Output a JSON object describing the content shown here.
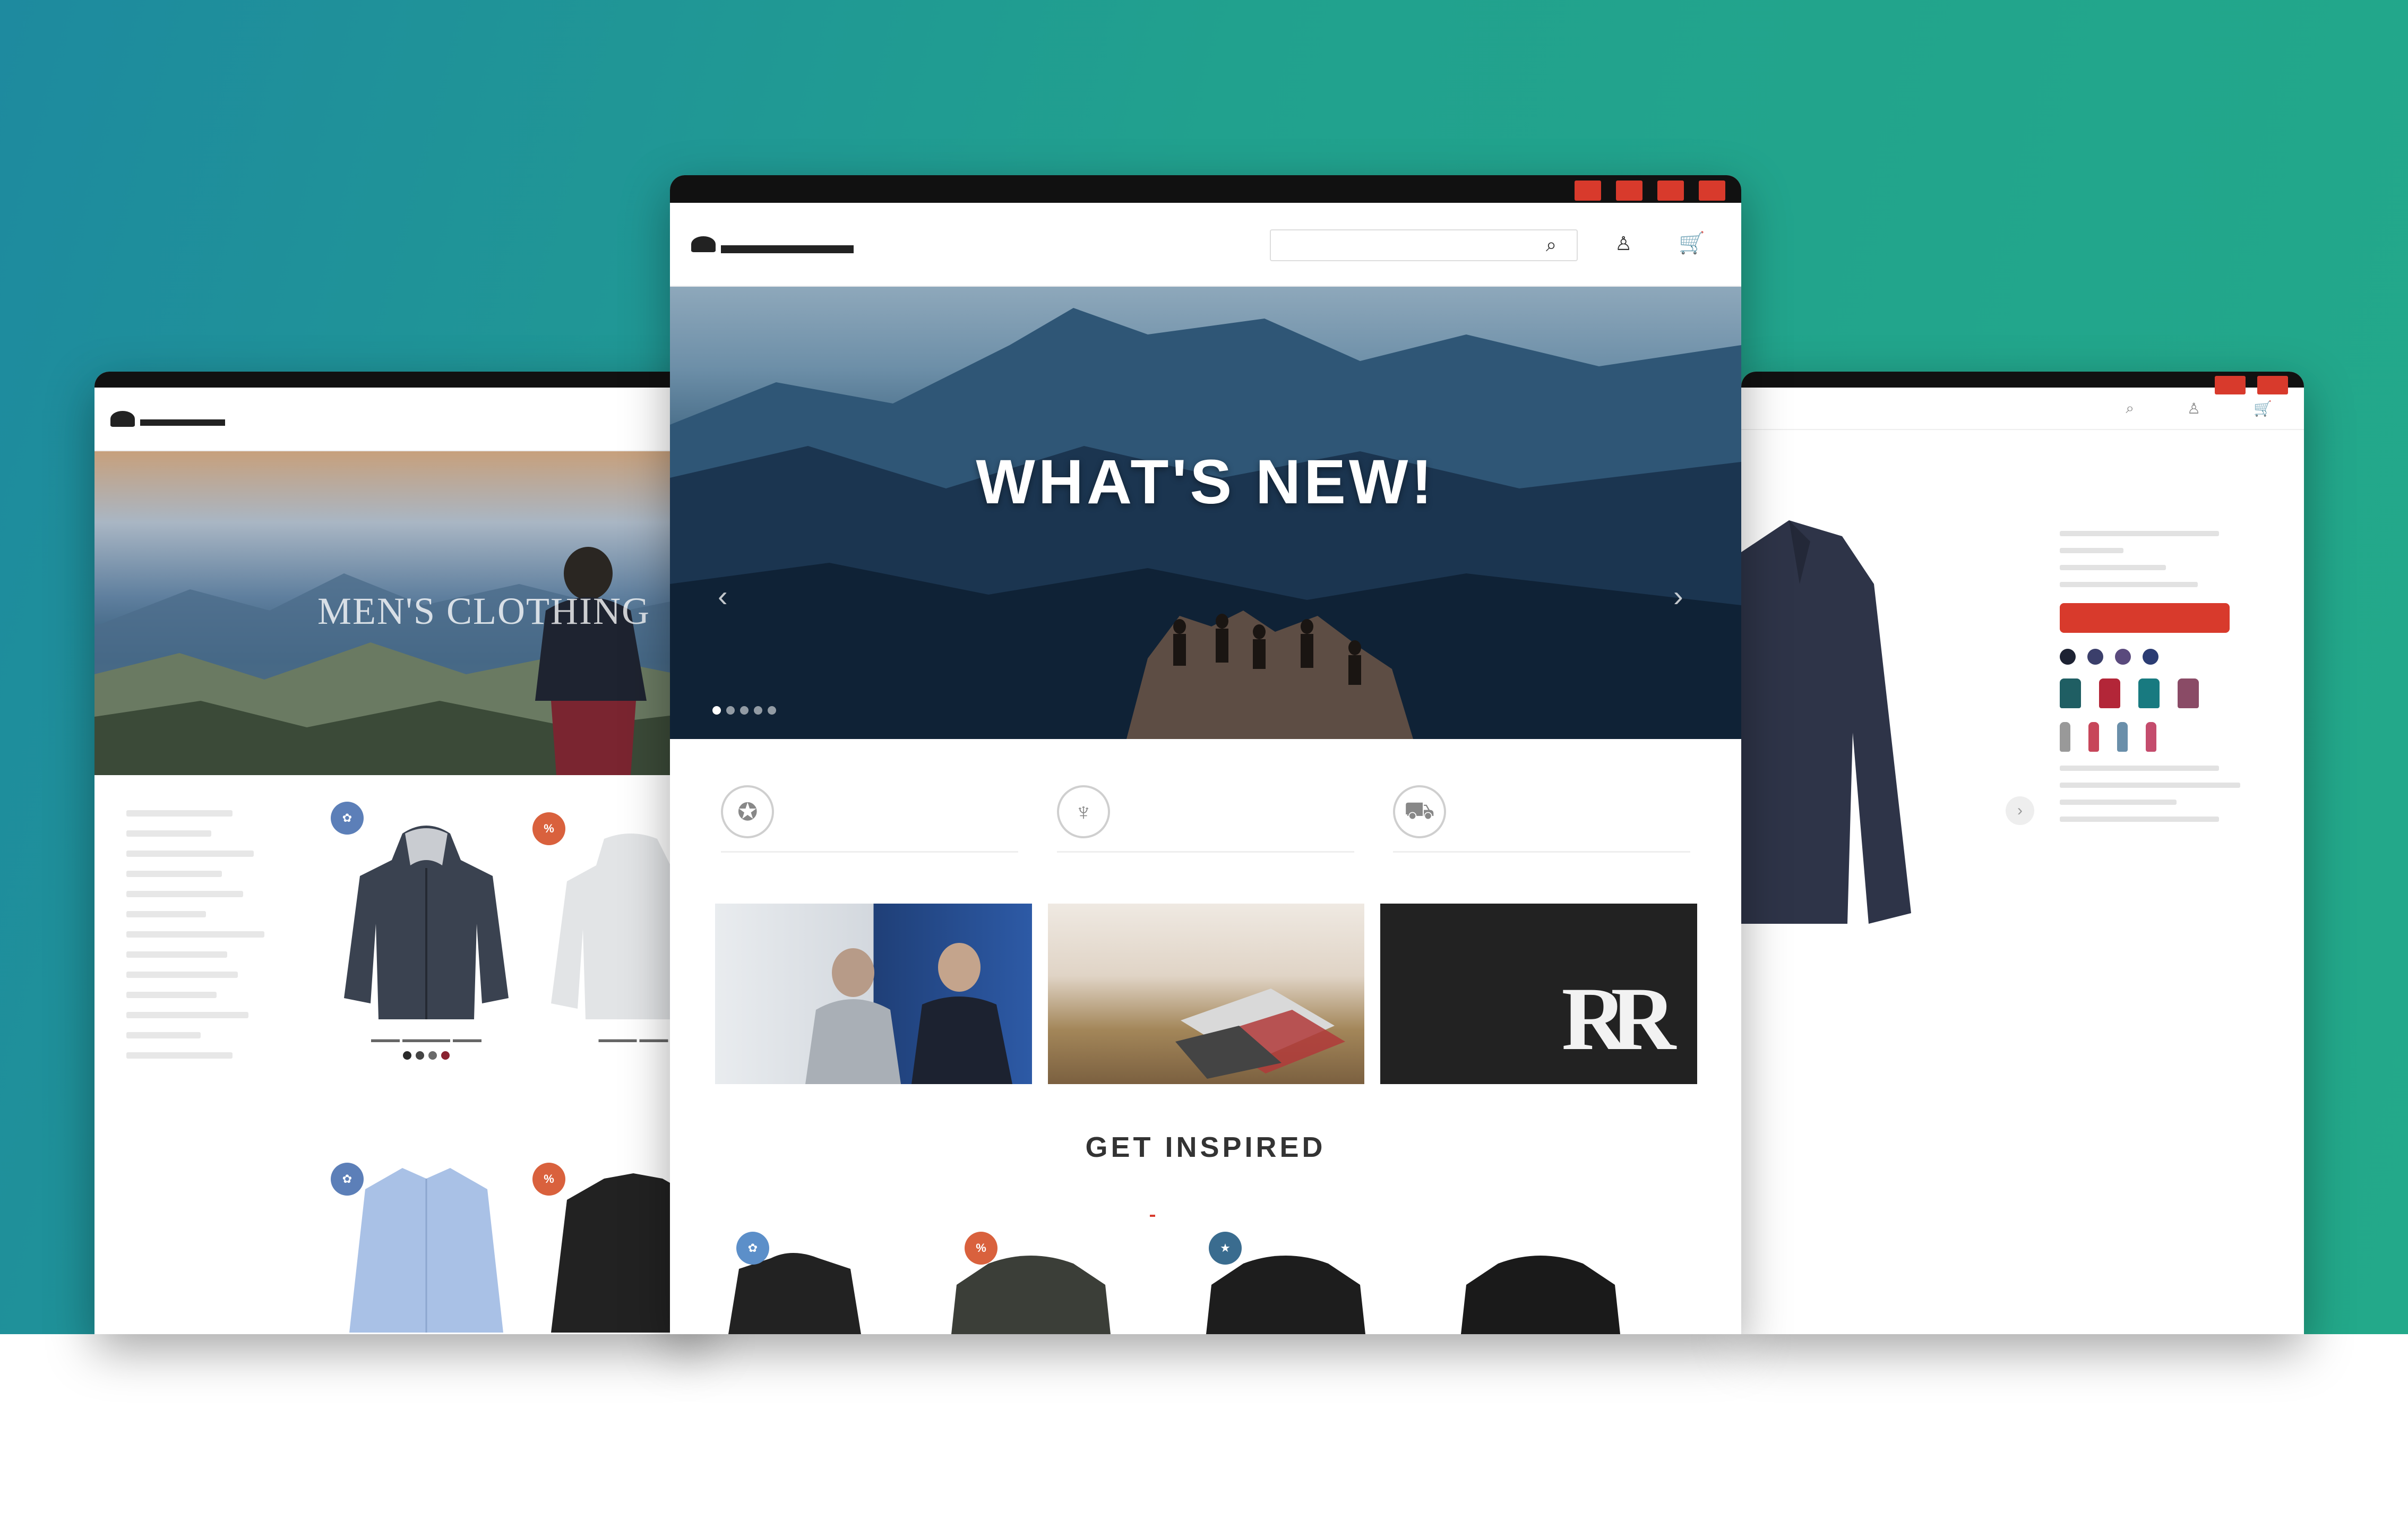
{
  "brand": {
    "colors": {
      "accent_red": "#d83a2c",
      "teal_bg": "#21a18e",
      "dark": "#111111",
      "hero_dark": "#10243b"
    }
  },
  "center": {
    "topbar_links": [
      "",
      "",
      "",
      ""
    ],
    "nav_items": [
      "",
      "",
      ""
    ],
    "search_placeholder": "",
    "icons": {
      "search": "search-icon",
      "user": "user-icon",
      "cart": "cart-icon"
    },
    "hero": {
      "title": "WHAT'S NEW!",
      "subtitle": ""
    },
    "features": [
      {
        "icon": "award-icon",
        "text": ""
      },
      {
        "icon": "trophy-icon",
        "text": ""
      },
      {
        "icon": "truck-icon",
        "text": ""
      }
    ],
    "tiles": [
      {
        "title": "",
        "subtitle": ""
      },
      {
        "title": "",
        "subtitle": ""
      },
      {
        "title": "",
        "subtitle": "",
        "monogram": "RR"
      }
    ],
    "inspired": {
      "title": "GET INSPIRED",
      "tabs": [
        "",
        "",
        ""
      ]
    }
  },
  "left": {
    "nav_items": [
      "",
      "",
      ""
    ],
    "hero_text": "MEN'S CLOTHING",
    "filters_title": ""
  },
  "right": {
    "product_name": "",
    "add_button": ""
  }
}
